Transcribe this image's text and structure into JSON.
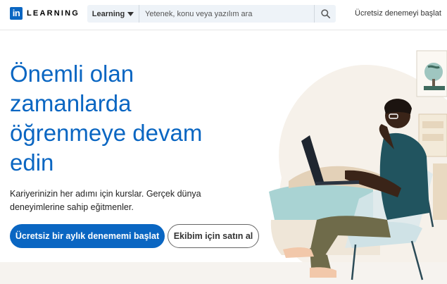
{
  "header": {
    "logo_letters": "in",
    "logo_word": "LEARNING",
    "search": {
      "dropdown_label": "Learning",
      "placeholder": "Yetenek, konu veya yazılım ara"
    },
    "trial_link": "Ücretsiz denemeyi başlat"
  },
  "hero": {
    "title": "Önemli olan zamanlarda öğrenmeye devam edin",
    "subtitle": "Kariyerinizin her adımı için kurslar. Gerçek dünya deneyimlerine sahip eğitmenler.",
    "primary_button": "Ücretsiz bir aylık denememi başlat",
    "secondary_button": "Ekibim için satın al"
  },
  "icons": {
    "dropdown": "chevron-down-icon",
    "search": "search-icon"
  },
  "colors": {
    "brand_blue": "#0a66c2",
    "search_bg": "#eef3f8"
  }
}
